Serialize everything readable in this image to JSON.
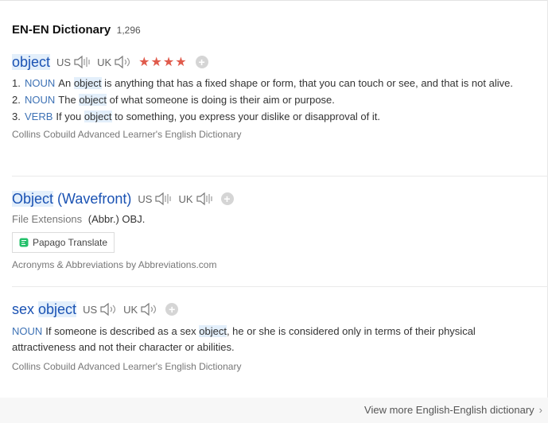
{
  "header": {
    "title": "EN-EN Dictionary",
    "count": "1,296"
  },
  "entries": [
    {
      "word_pre": "",
      "word_hl": "object",
      "word_post": "",
      "us": "US",
      "uk": "UK",
      "stars": "★★★★",
      "defs": [
        {
          "num": "1.",
          "pos": "NOUN",
          "pre": "An",
          "hl": "object",
          "post": "is anything that has a fixed shape or form, that you can touch or see, and that is not alive."
        },
        {
          "num": "2.",
          "pos": "NOUN",
          "pre": "The",
          "hl": "object",
          "post": "of what someone is doing is their aim or purpose."
        },
        {
          "num": "3.",
          "pos": "VERB",
          "pre": "If you",
          "hl": "object",
          "post": "to something, you express your dislike or disapproval of it."
        }
      ],
      "source": "Collins Cobuild Advanced Learner's English Dictionary"
    },
    {
      "word_pre": "",
      "word_hl": "Object",
      "word_post": " (Wavefront)",
      "us": "US",
      "uk": "UK",
      "file_ext_label": "File Extensions",
      "file_ext_value": "(Abbr.) OBJ.",
      "papago": "Papago Translate",
      "source": "Acronyms & Abbreviations by Abbreviations.com"
    },
    {
      "word_pre": "sex ",
      "word_hl": "object",
      "word_post": "",
      "us": "US",
      "uk": "UK",
      "def": {
        "pos": "NOUN",
        "pre": "If someone is described as a sex",
        "hl": "object",
        "post": ", he or she is considered only in terms of their physical attractiveness and not their character or abilities."
      },
      "source": "Collins Cobuild Advanced Learner's English Dictionary"
    }
  ],
  "footer": {
    "more": "View more English-English dictionary",
    "chevron": "›"
  },
  "icons": {
    "speaker": "speaker-icon",
    "add": "add-icon",
    "papago": "papago-icon"
  },
  "colors": {
    "link": "#1a52b3",
    "highlight": "#e3effb",
    "stars": "#e05b4c",
    "pos": "#3e72b5"
  }
}
